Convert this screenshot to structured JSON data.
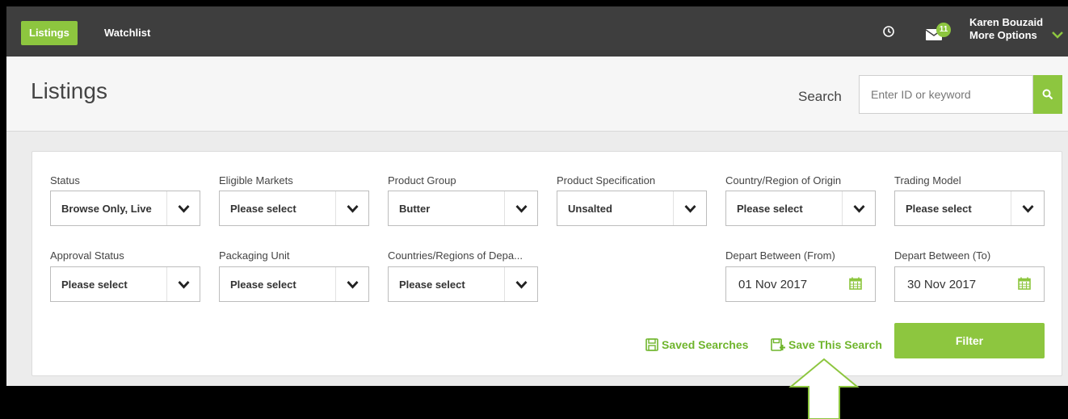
{
  "nav": {
    "active_tab": "Listings",
    "tab2": "Watchlist",
    "mail_badge": "11",
    "user_name": "Karen Bouzaid",
    "user_sub": "More Options"
  },
  "header": {
    "title": "Listings",
    "search_label": "Search",
    "search_placeholder": "Enter ID or keyword"
  },
  "filters": {
    "status": {
      "label": "Status",
      "value": "Browse Only, Live"
    },
    "eligible_markets": {
      "label": "Eligible Markets",
      "value": "Please select"
    },
    "product_group": {
      "label": "Product Group",
      "value": "Butter"
    },
    "product_spec": {
      "label": "Product Specification",
      "value": "Unsalted"
    },
    "country_origin": {
      "label": "Country/Region of Origin",
      "value": "Please select"
    },
    "trading_model": {
      "label": "Trading Model",
      "value": "Please select"
    },
    "approval_status": {
      "label": "Approval Status",
      "value": "Please select"
    },
    "packaging_unit": {
      "label": "Packaging Unit",
      "value": "Please select"
    },
    "countries_depart": {
      "label": "Countries/Regions of Depa...",
      "value": "Please select"
    },
    "depart_from": {
      "label": "Depart Between (From)",
      "value": "01 Nov 2017"
    },
    "depart_to": {
      "label": "Depart Between (To)",
      "value": "30 Nov 2017"
    }
  },
  "actions": {
    "saved_searches": "Saved Searches",
    "save_this_search": "Save This Search",
    "filter": "Filter"
  },
  "colors": {
    "accent": "#8dc63f",
    "nav_bg": "#3e3e3e",
    "link": "#6fb52c"
  }
}
